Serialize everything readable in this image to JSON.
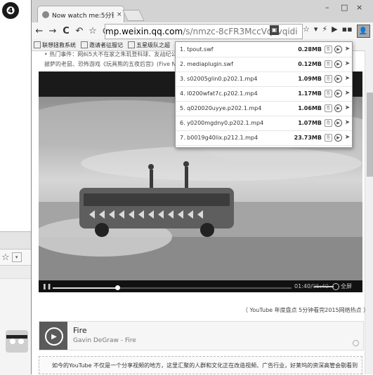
{
  "step_marker": "❹",
  "background_window": {
    "star_icon": "star-icon",
    "dropdown_icon": "chevron-down-icon"
  },
  "browser": {
    "tab_title": "Now watch me:5分钟看",
    "tab_close": "×",
    "window_controls": {
      "minimize": "–",
      "maximize": "□",
      "close": "×"
    },
    "nav": {
      "back": "←",
      "forward": "→",
      "reload": "C",
      "undo": "↶",
      "bookmark": "☆",
      "shield": "⊚"
    },
    "url_main": "mp.weixin.qq.com",
    "url_path": "/s/nmzc-8cFR3MccVqvvqidi",
    "toolbar_icons": {
      "star": "☆",
      "dropdown": "▾",
      "bolt": "⚡",
      "play": "▶",
      "grid": "▪▪",
      "extension": "👤",
      "share": "⎙",
      "menu": "≡"
    },
    "bookmarks": [
      "联想拯救系统",
      "邀请者征服记",
      "五星级队之超",
      "",
      ""
    ],
    "page_lines": [
      "• 热门事件：网纠5大不在家之朱玑登科球、友战纪公言",
      "披萨的老鼠、恐怖游戏《玩具熊的五夜后宫》(Five Ni"
    ]
  },
  "video": {
    "time_elapsed": "01:40",
    "time_total": "05:40",
    "fullscreen_label": "全屏",
    "progress": 0.27,
    "volume": 0.85
  },
  "caption": "（ YouTube 年度盘点 5分钟看完2015网络热点 ）",
  "music": {
    "song": "Fire",
    "artist": "Gavin DeGraw - Fire"
  },
  "paragraph": "如今的YouTube 不仅是一个分享视频的地方，这里汇聚的人群和文化正在改造视频、广告行业，好莱坞的资深高管会剔看到",
  "downloads": [
    {
      "name": "1. tpout.swf",
      "size": "0.28MB"
    },
    {
      "name": "2. mediaplugin.swf",
      "size": "0.12MB"
    },
    {
      "name": "3. s02005glin0.p202.1.mp4",
      "size": "1.09MB"
    },
    {
      "name": "4. l0200wfat7c.p202.1.mp4",
      "size": "1.17MB"
    },
    {
      "name": "5. q020020uyye.p202.1.mp4",
      "size": "1.06MB"
    },
    {
      "name": "6. y0200mgdny0.p202.1.mp4",
      "size": "1.07MB"
    },
    {
      "name": "7. b0019g40lix.p212.1.mp4",
      "size": "23.73MB"
    }
  ],
  "download_icons": {
    "copy": "copy-icon",
    "play": "play-icon",
    "save": "arrow-icon"
  }
}
